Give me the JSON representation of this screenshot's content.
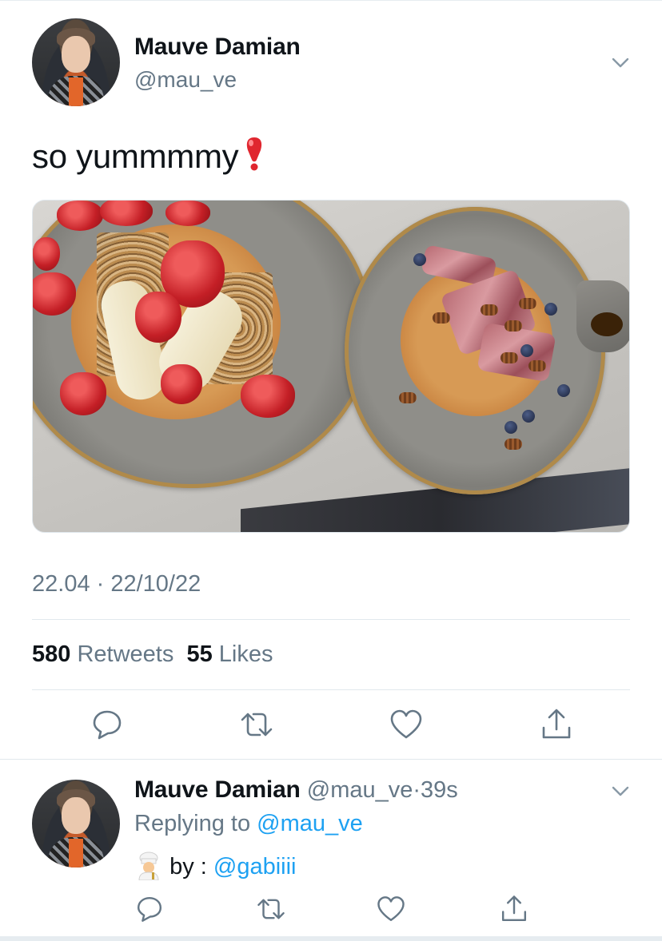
{
  "tweet": {
    "author_name": "Mauve Damian",
    "author_handle": "@mau_ve",
    "text": "so yummmmy",
    "timestamp": "22.04 · 22/10/22",
    "stats": {
      "retweets_count": "580",
      "retweets_label": "Retweets",
      "likes_count": "55",
      "likes_label": "Likes"
    },
    "actions": [
      "reply-icon",
      "retweet-icon",
      "like-icon",
      "share-icon"
    ]
  },
  "reply": {
    "author_name": "Mauve Damian",
    "author_handle": "@mau_ve",
    "dot": "·",
    "time": "39s",
    "replying_prefix": "Replying to",
    "replying_handle": "@mau_ve",
    "text_prefix": "by :",
    "mention": "@gabiiii",
    "actions": [
      "reply-icon",
      "retweet-icon",
      "like-icon",
      "share-icon"
    ]
  },
  "colors": {
    "text": "#0f1419",
    "muted": "#657786",
    "link": "#1da1f2",
    "divider": "#e1e8ed",
    "emoji_red": "#e0262f"
  }
}
